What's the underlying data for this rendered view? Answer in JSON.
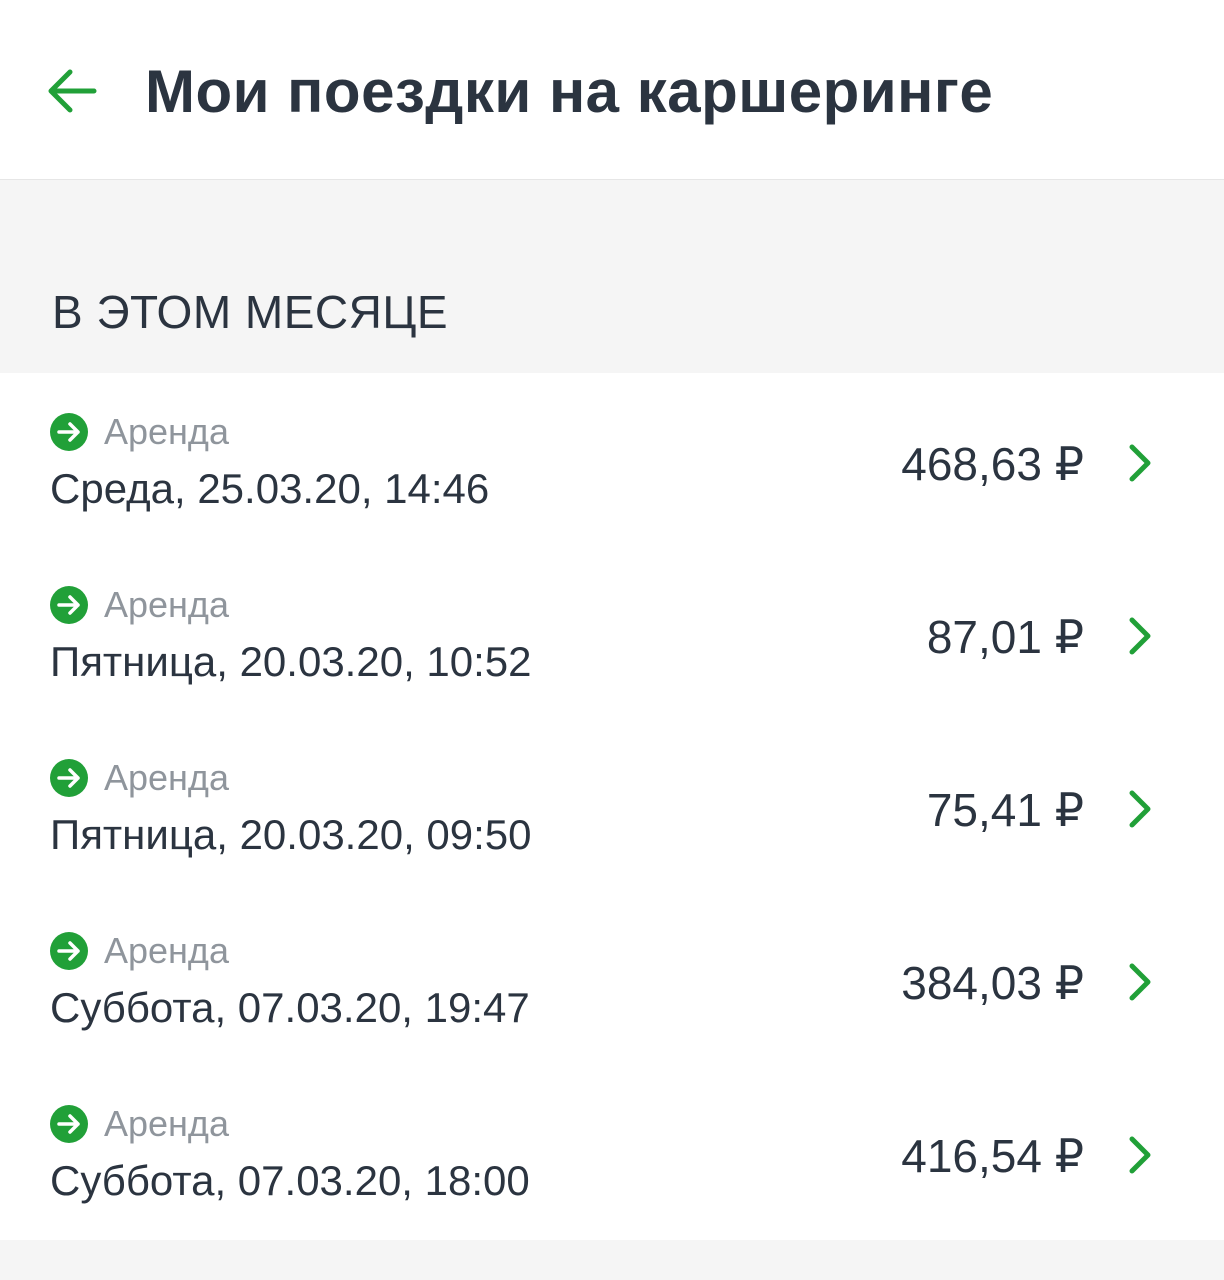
{
  "header": {
    "title": "Мои поездки на каршеринге",
    "back_icon": "arrow-left-icon"
  },
  "section": {
    "title": "В ЭТОМ МЕСЯЦЕ"
  },
  "colors": {
    "accent": "#21a038",
    "text": "#2b3440",
    "muted": "#8f959c",
    "background": "#f5f5f5"
  },
  "trips": [
    {
      "type": "Аренда",
      "date": "Среда, 25.03.20, 14:46",
      "amount": "468,63 ₽"
    },
    {
      "type": "Аренда",
      "date": "Пятница, 20.03.20, 10:52",
      "amount": "87,01 ₽"
    },
    {
      "type": "Аренда",
      "date": "Пятница, 20.03.20, 09:50",
      "amount": "75,41 ₽"
    },
    {
      "type": "Аренда",
      "date": "Суббота, 07.03.20, 19:47",
      "amount": "384,03 ₽"
    },
    {
      "type": "Аренда",
      "date": "Суббота, 07.03.20, 18:00",
      "amount": "416,54 ₽"
    }
  ]
}
